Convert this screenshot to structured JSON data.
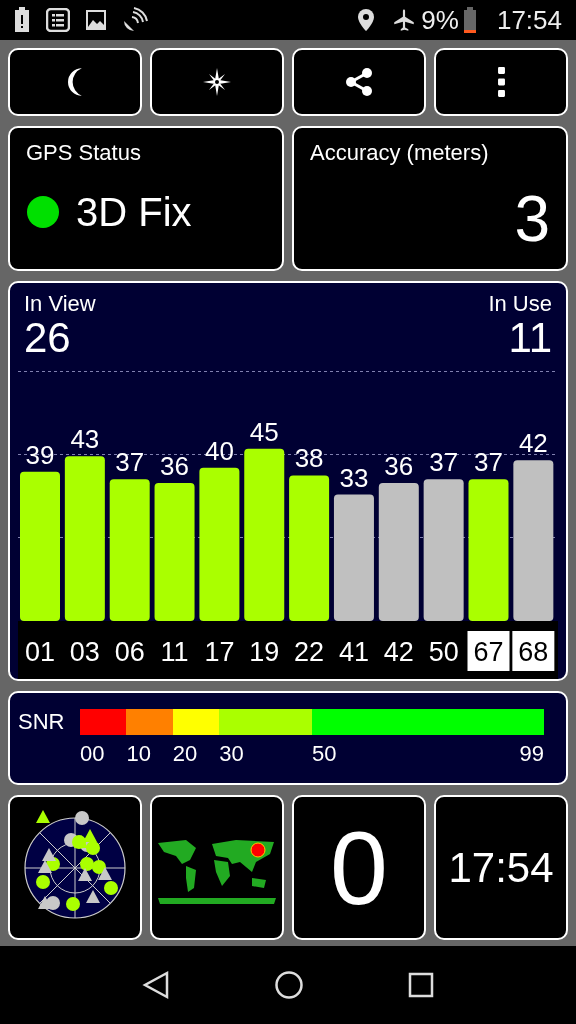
{
  "status_bar": {
    "battery": "9%",
    "time": "17:54"
  },
  "toolbar": [
    {
      "kind": "night"
    },
    {
      "kind": "compass"
    },
    {
      "kind": "share"
    },
    {
      "kind": "menu"
    }
  ],
  "gps_status": {
    "title": "GPS Status",
    "fix": "3D Fix"
  },
  "accuracy": {
    "title": "Accuracy (meters)",
    "value": "3"
  },
  "satellites": {
    "in_view_label": "In View",
    "in_view": "26",
    "in_use_label": "In Use",
    "in_use": "11",
    "chart_data": {
      "type": "bar",
      "categories": [
        "01",
        "03",
        "06",
        "11",
        "17",
        "19",
        "22",
        "41",
        "42",
        "50",
        "67",
        "68"
      ],
      "values": [
        39,
        43,
        37,
        36,
        40,
        45,
        38,
        33,
        36,
        37,
        37,
        42
      ],
      "data_labels": true
    },
    "bars": [
      {
        "in_use": true,
        "boxed": false
      },
      {
        "in_use": true,
        "boxed": false
      },
      {
        "in_use": true,
        "boxed": false
      },
      {
        "in_use": true,
        "boxed": false
      },
      {
        "in_use": true,
        "boxed": false
      },
      {
        "in_use": true,
        "boxed": false
      },
      {
        "in_use": true,
        "boxed": false
      },
      {
        "in_use": false,
        "boxed": false
      },
      {
        "in_use": false,
        "boxed": false
      },
      {
        "in_use": false,
        "boxed": false
      },
      {
        "in_use": true,
        "boxed": true
      },
      {
        "in_use": false,
        "boxed": true
      }
    ]
  },
  "snr": {
    "label": "SNR",
    "segments": [
      {
        "label": "00",
        "color": "#ff0000"
      },
      {
        "label": "10",
        "color": "#ff8000"
      },
      {
        "label": "20",
        "color": "#ffff00"
      },
      {
        "label": "30",
        "color": "#aaff00"
      },
      {
        "label": "50",
        "color": "#00ff00"
      }
    ],
    "end_label": "99"
  },
  "tiles": {
    "count": "0",
    "time": "17:54"
  }
}
